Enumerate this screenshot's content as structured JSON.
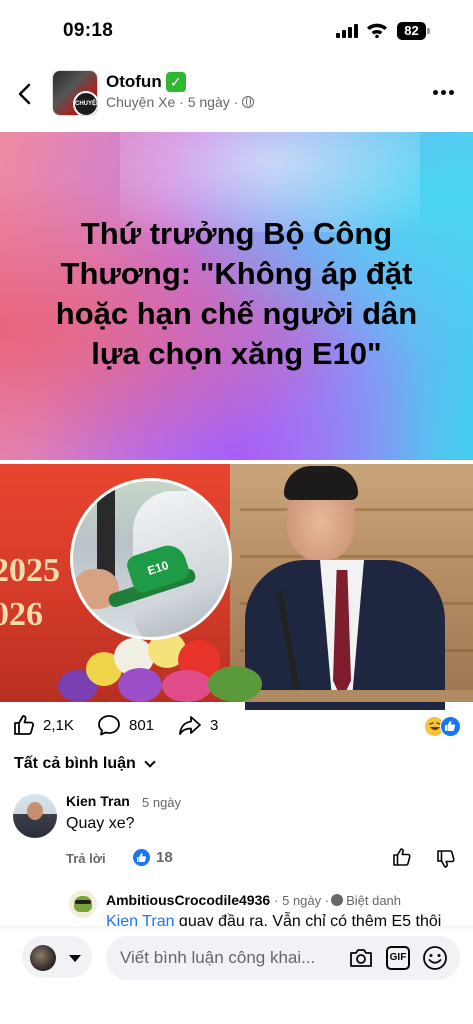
{
  "status_bar": {
    "time": "09:18",
    "battery": "82"
  },
  "header": {
    "page_name": "Otofun",
    "verified_mark": "✓",
    "avatar_text": "CHUYỆN XE",
    "meta": "Chuyện Xe · 5 ngày ·"
  },
  "post": {
    "banner_title": "Thứ trưởng Bộ Công Thương: \"Không áp đặt hoặc hạn chế người dân lựa chọn xăng E10\"",
    "photo_year_1": "2025",
    "photo_year_2": "026",
    "nozzle_label": "E10"
  },
  "stats": {
    "likes": "2,1K",
    "comments": "801",
    "shares": "3"
  },
  "comments_filter": "Tất cả bình luận",
  "comments": [
    {
      "author": "Kien Tran",
      "time": "5 ngày",
      "text": "Quay xe?",
      "reply_label": "Trả lời",
      "like_count": "18"
    }
  ],
  "reply": {
    "author": "AmbitiousCrocodile4936",
    "time": "· 5 ngày ·",
    "badge": "Biệt danh",
    "mention": "Kien Tran",
    "text": " quay đầu ra. Vẫn chỉ có thêm E5 thôi"
  },
  "composer": {
    "placeholder": "Viết bình luận công khai..."
  },
  "icons": {
    "back": "chevron-left-icon",
    "more": "more-horizontal-icon",
    "like": "thumb-up-icon",
    "comment": "comment-bubble-icon",
    "share": "share-arrow-icon",
    "camera": "camera-icon",
    "gif": "gif-icon",
    "emoji": "emoji-icon",
    "globe": "globe-icon"
  },
  "colors": {
    "accent": "#1877f2",
    "secondary_text": "#65676b",
    "input_bg": "#f0f2f5"
  }
}
